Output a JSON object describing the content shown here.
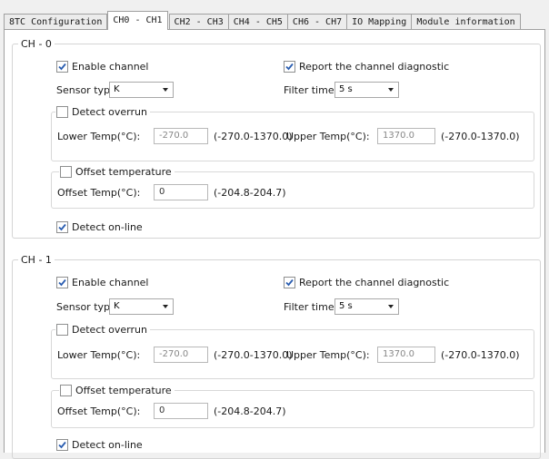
{
  "tabs": [
    {
      "label": "8TC Configuration"
    },
    {
      "label": "CH0 - CH1"
    },
    {
      "label": "CH2 - CH3"
    },
    {
      "label": "CH4 - CH5"
    },
    {
      "label": "CH6 - CH7"
    },
    {
      "label": "IO Mapping"
    },
    {
      "label": "Module information"
    }
  ],
  "active_tab": "CH0 - CH1",
  "channels": [
    {
      "title": "CH - 0",
      "enable_label": "Enable channel",
      "enable_checked": true,
      "diag_label": "Report the channel diagnostic",
      "diag_checked": true,
      "sensor_label": "Sensor type:",
      "sensor_value": "K",
      "filter_label": "Filter time:",
      "filter_value": "5 s",
      "overrun_label": "Detect overrun",
      "overrun_checked": false,
      "lower_label": "Lower Temp(°C):",
      "lower_value": "-270.0",
      "lower_range": "(-270.0-1370.0)",
      "upper_label": "Upper Temp(°C):",
      "upper_value": "1370.0",
      "upper_range": "(-270.0-1370.0)",
      "offset_group_label": "Offset temperature",
      "offset_group_checked": false,
      "offset_label": "Offset Temp(°C):",
      "offset_value": "0",
      "offset_range": "(-204.8-204.7)",
      "online_label": "Detect on-line",
      "online_checked": true
    },
    {
      "title": "CH - 1",
      "enable_label": "Enable channel",
      "enable_checked": true,
      "diag_label": "Report the channel diagnostic",
      "diag_checked": true,
      "sensor_label": "Sensor type:",
      "sensor_value": "K",
      "filter_label": "Filter time:",
      "filter_value": "5 s",
      "overrun_label": "Detect overrun",
      "overrun_checked": false,
      "lower_label": "Lower Temp(°C):",
      "lower_value": "-270.0",
      "lower_range": "(-270.0-1370.0)",
      "upper_label": "Upper Temp(°C):",
      "upper_value": "1370.0",
      "upper_range": "(-270.0-1370.0)",
      "offset_group_label": "Offset temperature",
      "offset_group_checked": false,
      "offset_label": "Offset Temp(°C):",
      "offset_value": "0",
      "offset_range": "(-204.8-204.7)",
      "online_label": "Detect on-line",
      "online_checked": true
    }
  ]
}
